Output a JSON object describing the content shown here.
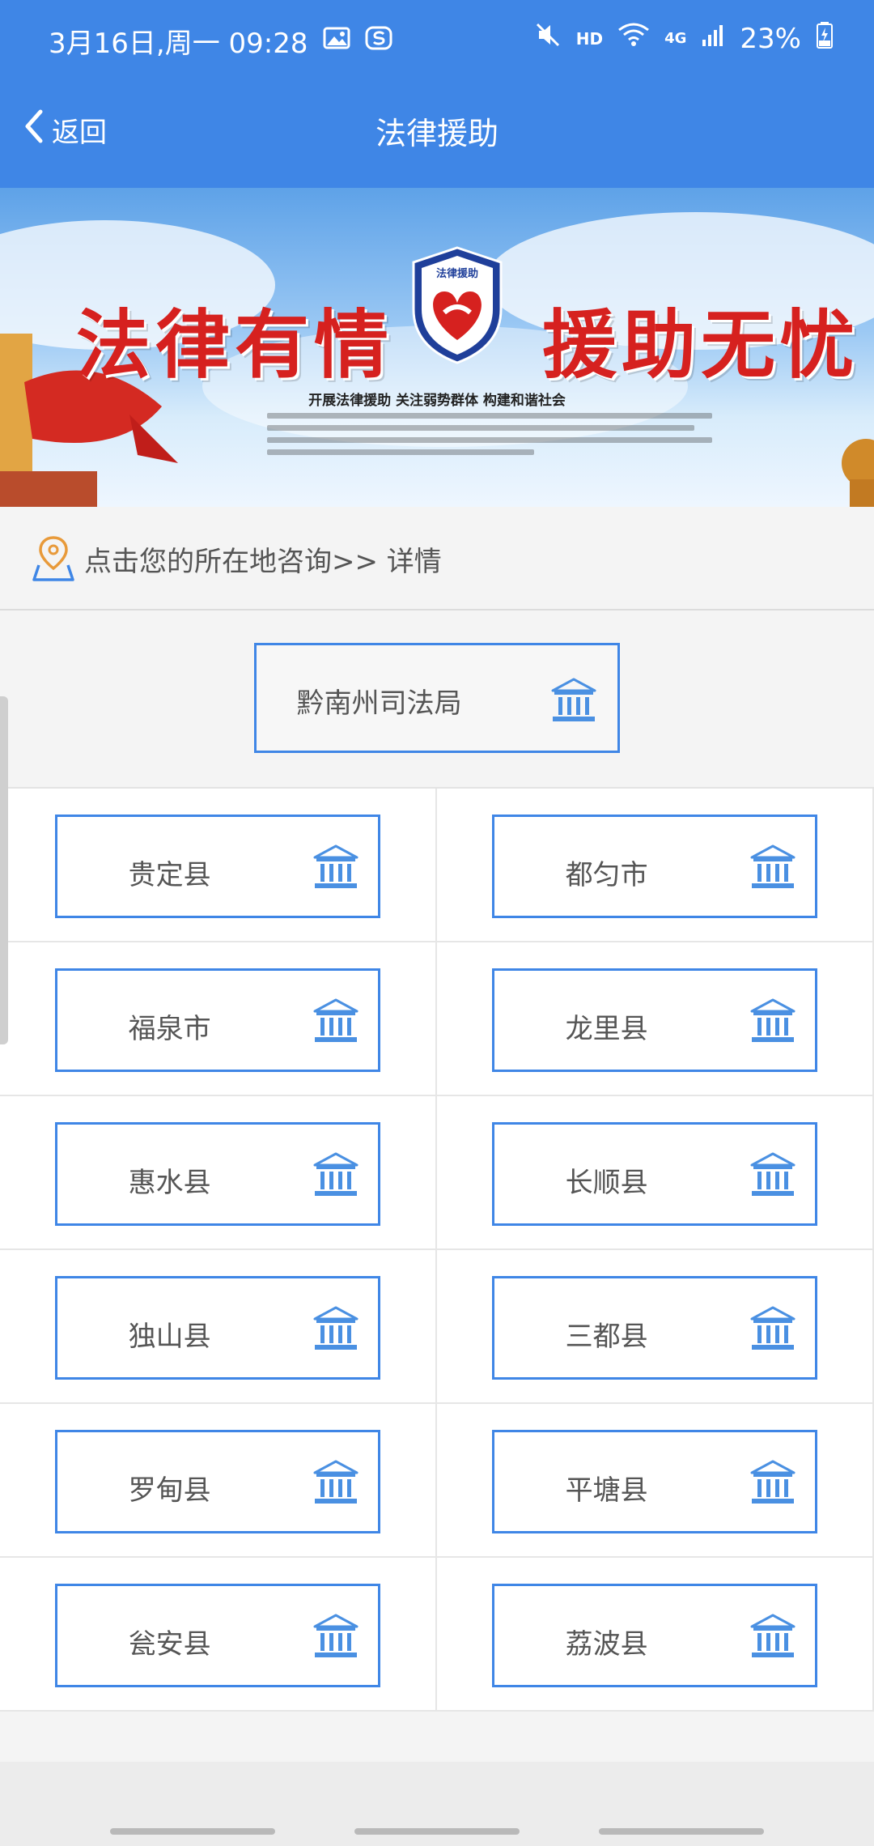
{
  "status_bar": {
    "time": "3月16日,周一  09:28",
    "hd": "HD",
    "network": "4G",
    "battery": "23%"
  },
  "nav": {
    "back_label": "返回",
    "title": "法律援助"
  },
  "banner": {
    "left_text": "法律有情",
    "right_text": "援助无忧",
    "shield_text": "法律援助",
    "slogan": "开展法律援助 关注弱势群体  构建和谐社会"
  },
  "location": {
    "text": "点击您的所在地咨询>> 详情"
  },
  "main_office": {
    "label": "黔南州司法局"
  },
  "counties": [
    {
      "label": "贵定县"
    },
    {
      "label": "都匀市"
    },
    {
      "label": "福泉市"
    },
    {
      "label": "龙里县"
    },
    {
      "label": "惠水县"
    },
    {
      "label": "长顺县"
    },
    {
      "label": "独山县"
    },
    {
      "label": "三都县"
    },
    {
      "label": "罗甸县"
    },
    {
      "label": "平塘县"
    },
    {
      "label": "瓮安县"
    },
    {
      "label": "荔波县"
    }
  ],
  "colors": {
    "primary": "#3f86e6",
    "banner_red": "#d6211f"
  }
}
